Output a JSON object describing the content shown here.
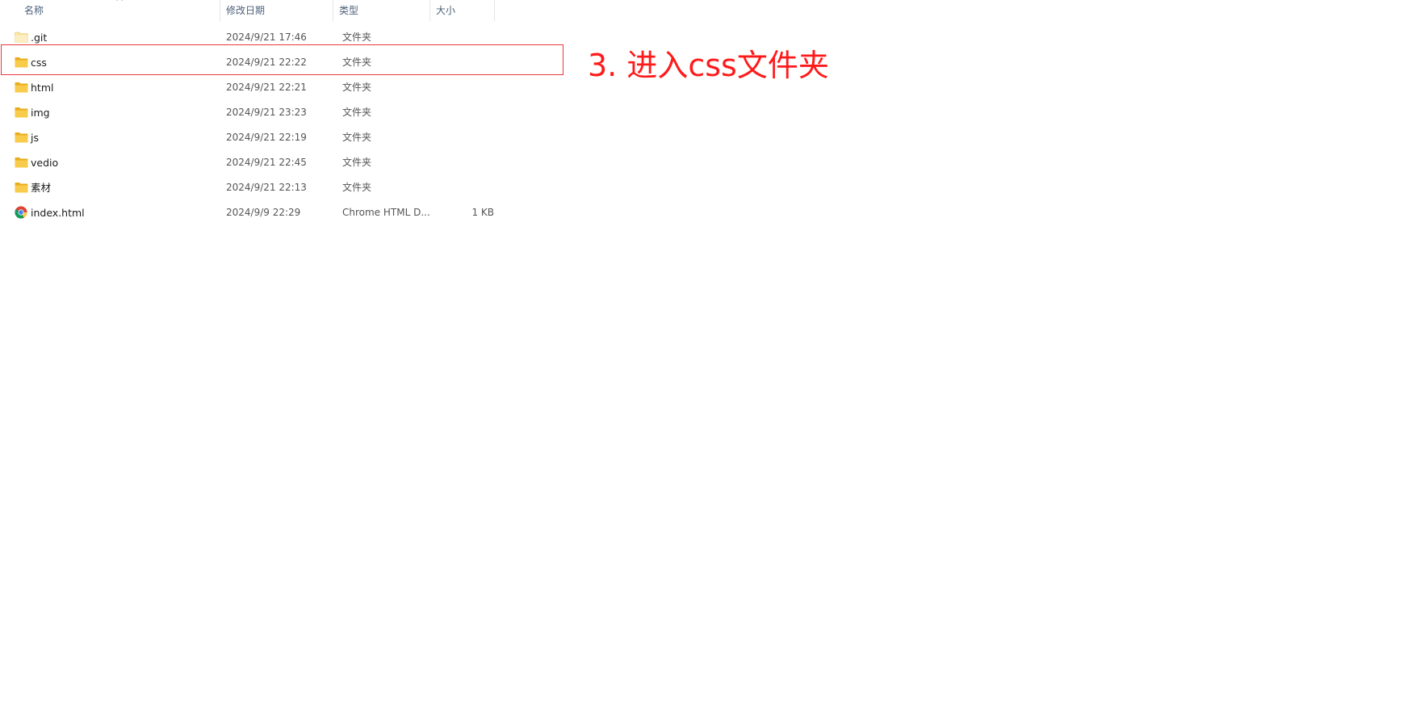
{
  "header": {
    "columns": [
      {
        "label": "名称"
      },
      {
        "label": "修改日期"
      },
      {
        "label": "类型"
      },
      {
        "label": "大小"
      }
    ],
    "sort_indicator": "^"
  },
  "files": [
    {
      "name": ".git",
      "date": "2024/9/21 17:46",
      "type": "文件夹",
      "size": "",
      "icon": "folder-icon-light"
    },
    {
      "name": "css",
      "date": "2024/9/21 22:22",
      "type": "文件夹",
      "size": "",
      "icon": "folder-icon"
    },
    {
      "name": "html",
      "date": "2024/9/21 22:21",
      "type": "文件夹",
      "size": "",
      "icon": "folder-icon"
    },
    {
      "name": "img",
      "date": "2024/9/21 23:23",
      "type": "文件夹",
      "size": "",
      "icon": "folder-icon"
    },
    {
      "name": "js",
      "date": "2024/9/21 22:19",
      "type": "文件夹",
      "size": "",
      "icon": "folder-icon"
    },
    {
      "name": "vedio",
      "date": "2024/9/21 22:45",
      "type": "文件夹",
      "size": "",
      "icon": "folder-icon"
    },
    {
      "name": "素材",
      "date": "2024/9/21 22:13",
      "type": "文件夹",
      "size": "",
      "icon": "folder-icon"
    },
    {
      "name": "index.html",
      "date": "2024/9/9 22:29",
      "type": "Chrome HTML D...",
      "size": "1 KB",
      "icon": "chrome-icon"
    }
  ],
  "annotation": {
    "text": "3. 进入css文件夹",
    "color": "#ff1a1a"
  },
  "colors": {
    "highlight_border": "#e8383d",
    "folder": "#f5c542",
    "header_text": "#4c607a"
  }
}
